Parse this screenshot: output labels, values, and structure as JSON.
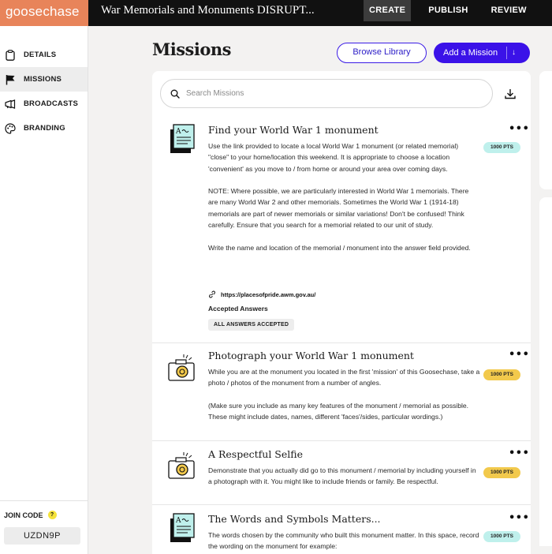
{
  "brand": {
    "logo_text": "goosechase",
    "logo_color": "#e8845a"
  },
  "header": {
    "game_title": "War Memorials and Monuments DISRUPT...",
    "tabs": [
      {
        "label": "CREATE",
        "active": true
      },
      {
        "label": "PUBLISH",
        "active": false
      },
      {
        "label": "REVIEW",
        "active": false
      }
    ]
  },
  "sidebar": {
    "items": [
      {
        "label": "DETAILS",
        "icon": "clipboard-icon"
      },
      {
        "label": "MISSIONS",
        "icon": "flag-icon",
        "active": true
      },
      {
        "label": "BROADCASTS",
        "icon": "megaphone-icon"
      },
      {
        "label": "BRANDING",
        "icon": "palette-icon"
      }
    ],
    "join": {
      "label": "JOIN CODE",
      "help": "?",
      "code": "UZDN9P"
    }
  },
  "main": {
    "title": "Missions",
    "browse_label": "Browse Library",
    "add_label": "Add a Mission",
    "add_arrow": "↓",
    "search_placeholder": "Search Missions"
  },
  "missions": [
    {
      "title": "Find your World War 1 monument",
      "type": "text",
      "points": "1000 PTS",
      "points_color": "#bff0ec",
      "paragraphs": [
        "Use the link provided to locate a local World War 1 monument (or related memorial) \"close\" to your home/location this weekend. It is appropriate to choose a location 'convenient' as you move to / from home or around your area over coming days.",
        "NOTE: Where possible, we are particularly interested in World War 1 memorials. There are many World War 2 and other memorials. Sometimes the World War 1 (1914-18) memorials are part of newer memorials or similar variations! Don't be confused! Think carefully. Ensure that you search for a memorial related to our unit of study.",
        "Write the name and location of the memorial / monument into the answer field provided."
      ],
      "link": "https://placesofpride.awm.gov.au/",
      "accepted_heading": "Accepted Answers",
      "accepted_chip": "ALL ANSWERS ACCEPTED"
    },
    {
      "title": "Photograph your World War 1 monument",
      "type": "photo",
      "points": "1000 PTS",
      "points_color": "#f2c94c",
      "paragraphs": [
        "While you are at the monument you located in the first 'mission' of this Goosechase, take a photo / photos of the monument from a number of angles.",
        "(Make sure you include as many key features of the monument / memorial as possible. These might include dates, names, different 'faces'/sides, particular wordings.)"
      ]
    },
    {
      "title": "A Respectful Selfie",
      "type": "photo",
      "points": "1000 PTS",
      "points_color": "#f2c94c",
      "paragraphs": [
        "Demonstrate that you actually did go to this monument / memorial by including yourself in a photograph with it. You might like to include friends or family. Be respectful."
      ]
    },
    {
      "title": "The Words and Symbols Matters...",
      "type": "text",
      "points": "1000 PTS",
      "points_color": "#bff0ec",
      "paragraphs": [
        "The words chosen by the community who built this monument matter. In this space, record the wording on the monument for example:"
      ]
    }
  ]
}
